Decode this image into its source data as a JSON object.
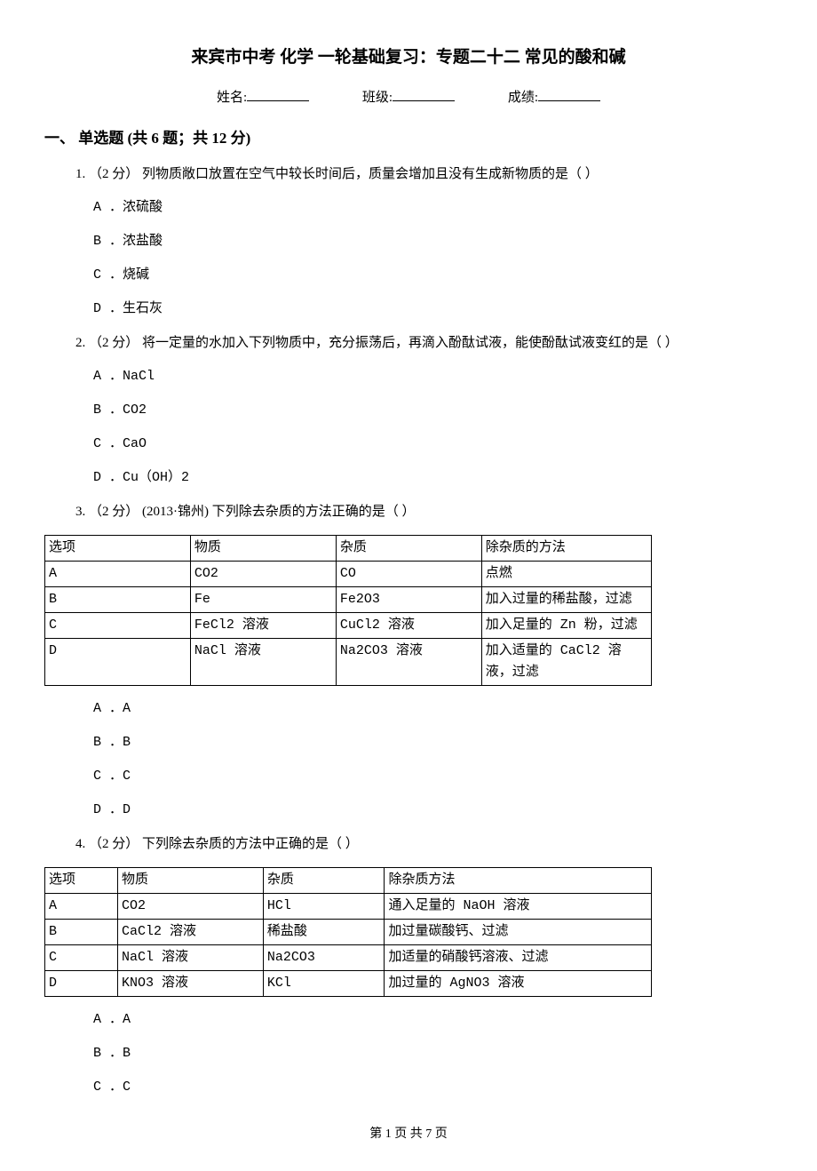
{
  "title": "来宾市中考 化学 一轮基础复习：专题二十二 常见的酸和碱",
  "meta": {
    "name_label": "姓名:",
    "class_label": "班级:",
    "score_label": "成绩:"
  },
  "section1": {
    "header": "一、 单选题 (共 6 题；共 12 分)",
    "q1": {
      "stem": "1.  （2 分） 列物质敞口放置在空气中较长时间后，质量会增加且没有生成新物质的是（    ）",
      "a": "A ．浓硫酸",
      "b": "B ．浓盐酸",
      "c": "C ．烧碱",
      "d": "D ．生石灰"
    },
    "q2": {
      "stem": "2.  （2 分） 将一定量的水加入下列物质中，充分振荡后，再滴入酚酞试液，能使酚酞试液变红的是（    ）",
      "a": "A ．NaCl",
      "b": "B ．CO2",
      "c": "C ．CaO",
      "d": "D ．Cu（OH）2"
    },
    "q3": {
      "stem": "3.  （2 分） (2013·锦州) 下列除去杂质的方法正确的是（    ）",
      "table_headers": {
        "c0": "选项",
        "c1": "物质",
        "c2": "杂质",
        "c3": "除杂质的方法"
      },
      "rows": [
        {
          "c0": "A",
          "c1": "CO2",
          "c2": "CO",
          "c3": "点燃"
        },
        {
          "c0": "B",
          "c1": "Fe",
          "c2": "Fe2O3",
          "c3": "加入过量的稀盐酸，过滤"
        },
        {
          "c0": "C",
          "c1": "FeCl2 溶液",
          "c2": "CuCl2 溶液",
          "c3": "加入足量的 Zn 粉，过滤"
        },
        {
          "c0": "D",
          "c1": "NaCl 溶液",
          "c2": "Na2CO3 溶液",
          "c3": "加入适量的 CaCl2 溶液，过滤"
        }
      ],
      "a": "A ．A",
      "b": "B ．B",
      "c": "C ．C",
      "d": "D ．D"
    },
    "q4": {
      "stem": "4.  （2 分） 下列除去杂质的方法中正确的是（    ）",
      "table_headers": {
        "c0": "选项",
        "c1": "物质",
        "c2": "杂质",
        "c3": "除杂质方法"
      },
      "rows": [
        {
          "c0": "A",
          "c1": "CO2",
          "c2": "HCl",
          "c3": "通入足量的 NaOH 溶液"
        },
        {
          "c0": "B",
          "c1": "CaCl2 溶液",
          "c2": "稀盐酸",
          "c3": "加过量碳酸钙、过滤"
        },
        {
          "c0": "C",
          "c1": "NaCl 溶液",
          "c2": "Na2CO3",
          "c3": "加适量的硝酸钙溶液、过滤"
        },
        {
          "c0": "D",
          "c1": "KNO3 溶液",
          "c2": "KCl",
          "c3": "加过量的 AgNO3 溶液"
        }
      ],
      "a": "A ．A",
      "b": "B ．B",
      "c": "C ．C"
    }
  },
  "footer": "第 1 页 共 7 页"
}
